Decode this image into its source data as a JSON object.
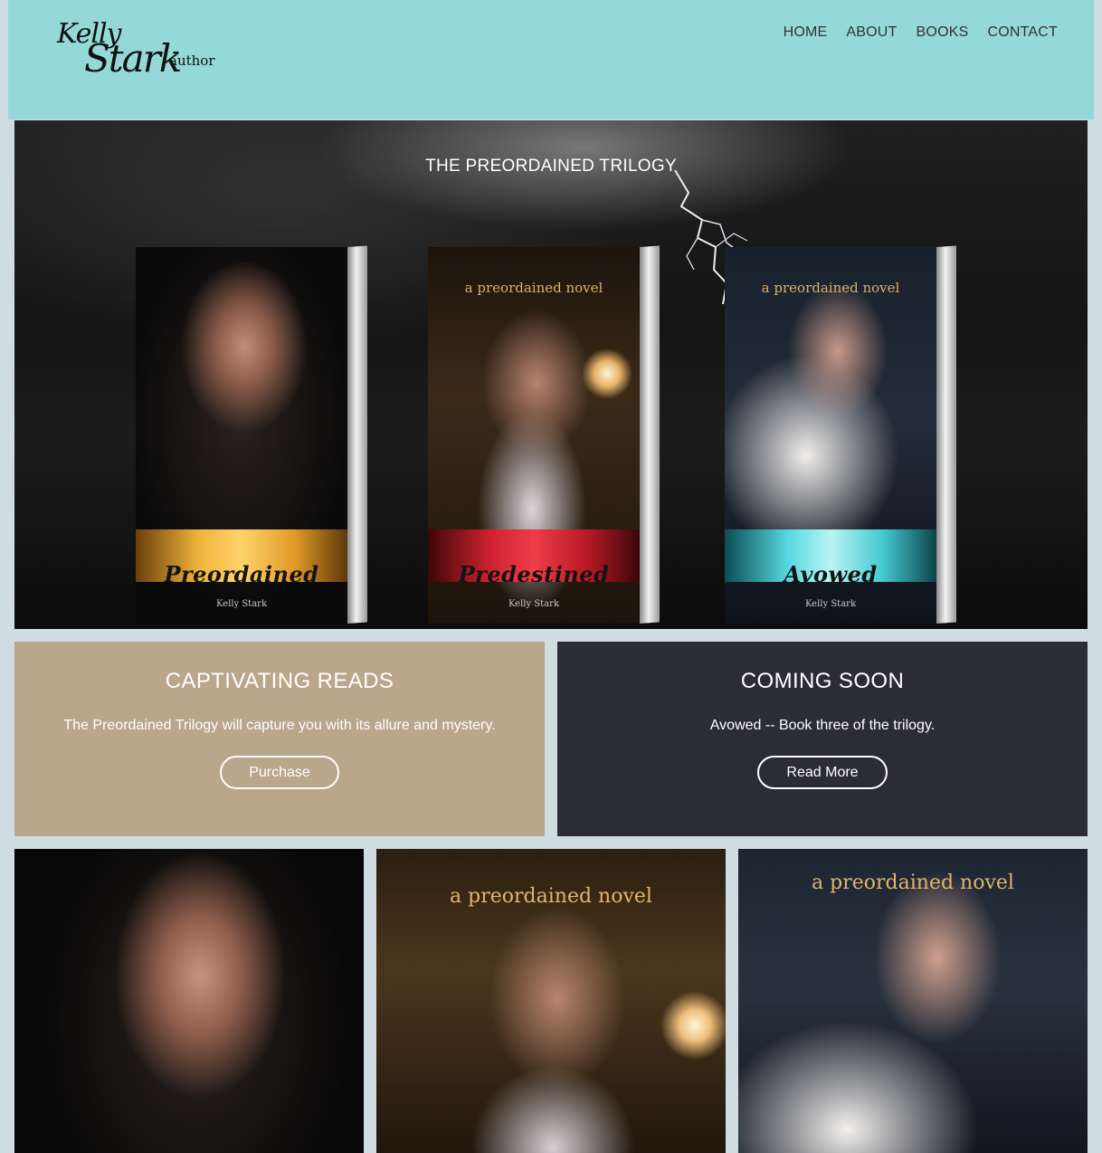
{
  "header": {
    "logo": {
      "line1": "Kelly",
      "line2": "Stark",
      "line3": "author"
    },
    "nav": [
      "HOME",
      "ABOUT",
      "BOOKS",
      "CONTACT"
    ],
    "background": "#94d9d7"
  },
  "hero": {
    "title": "THE PREORDAINED TRILOGY",
    "books": [
      {
        "tagline": "",
        "title": "Preordained",
        "author": "Kelly Stark",
        "band_color": "#f0b43c"
      },
      {
        "tagline": "a preordained novel",
        "title": "Predestined",
        "author": "Kelly Stark",
        "band_color": "#cf2330"
      },
      {
        "tagline": "a preordained novel",
        "title": "Avowed",
        "author": "Kelly Stark",
        "band_color": "#56d9e0"
      }
    ]
  },
  "panels": {
    "left": {
      "heading": "CAPTIVATING READS",
      "text": "The Preordained Trilogy will capture you with its allure and mystery.",
      "button": "Purchase",
      "background": "#b9a68b"
    },
    "right": {
      "heading": "COMING SOON",
      "text": "Avowed -- Book three of the trilogy.",
      "button": "Read More",
      "background": "#2b2c36"
    }
  },
  "tiles": [
    {
      "tagline": ""
    },
    {
      "tagline": "a preordained novel"
    },
    {
      "tagline": "a preordained novel"
    }
  ],
  "colors": {
    "page_background": "#cfdde2",
    "text_light": "#ffffff",
    "nav_text": "#333333"
  }
}
